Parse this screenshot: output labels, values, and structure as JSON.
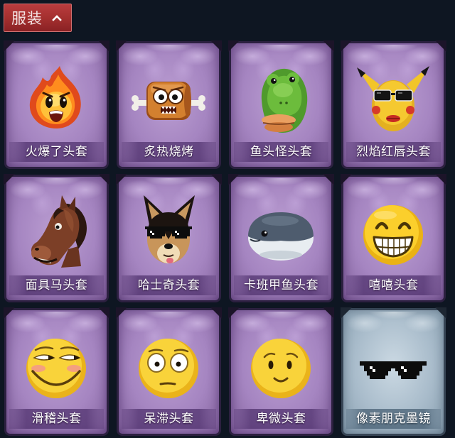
{
  "header": {
    "title": "服装",
    "toggle_icon": "chevron-up-icon"
  },
  "colors": {
    "page_bg": "#0e1622",
    "header_bg": "#a5302f",
    "card_purple": "#a585c1",
    "card_silver_blue": "#a9bccb"
  },
  "items": [
    {
      "name": "火爆了头套",
      "icon": "fire-head-icon",
      "theme": "purple"
    },
    {
      "name": "炙热烧烤",
      "icon": "roast-meat-icon",
      "theme": "purple"
    },
    {
      "name": "鱼头怪头套",
      "icon": "fish-head-icon",
      "theme": "purple"
    },
    {
      "name": "烈焰红唇头套",
      "icon": "yellow-creature-sunglasses-icon",
      "theme": "purple"
    },
    {
      "name": "面具马头套",
      "icon": "horse-head-icon",
      "theme": "purple"
    },
    {
      "name": "哈士奇头套",
      "icon": "husky-head-icon",
      "theme": "purple"
    },
    {
      "name": "卡班甲鱼头套",
      "icon": "round-fish-head-icon",
      "theme": "purple"
    },
    {
      "name": "嘻嘻头套",
      "icon": "grinning-emoji-icon",
      "theme": "purple"
    },
    {
      "name": "滑稽头套",
      "icon": "funny-face-emoji-icon",
      "theme": "purple"
    },
    {
      "name": "呆滞头套",
      "icon": "dazed-emoji-icon",
      "theme": "purple"
    },
    {
      "name": "卑微头套",
      "icon": "timid-emoji-icon",
      "theme": "purple"
    },
    {
      "name": "像素朋克墨镜",
      "icon": "pixel-sunglasses-icon",
      "theme": "silver-blue"
    }
  ]
}
